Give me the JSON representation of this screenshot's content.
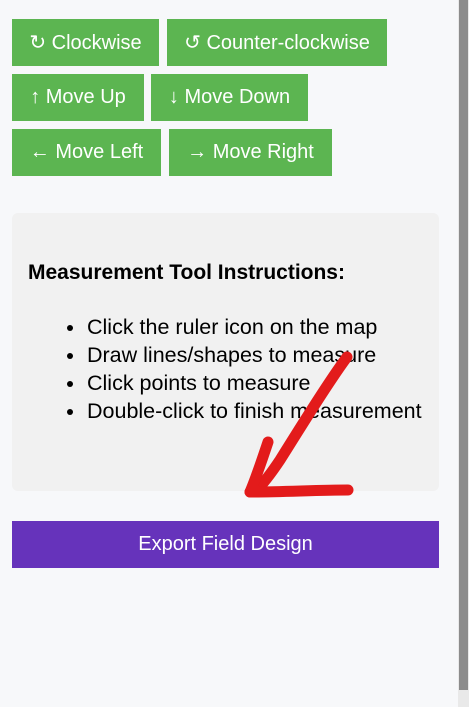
{
  "controls": {
    "clockwise_label": "↻ Clockwise",
    "counter_clockwise_label": "↺ Counter-clockwise",
    "move_up_label": "↑ Move Up",
    "move_down_label": "↓ Move Down",
    "move_left_label": "← Move Left",
    "move_right_label": "→ Move Right"
  },
  "instructions": {
    "title": "Measurement Tool Instructions:",
    "items": [
      "Click the ruler icon on the map",
      "Draw lines/shapes to measure",
      "Click points to measure",
      "Double-click to finish measurement"
    ]
  },
  "export": {
    "label": "Export Field Design"
  },
  "colors": {
    "button_green": "#5cb551",
    "export_purple": "#6633bb",
    "annotation_red": "#e31b1b"
  }
}
